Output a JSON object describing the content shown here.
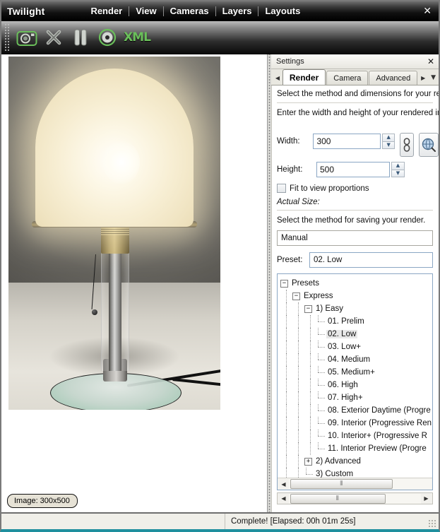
{
  "window": {
    "title": "Twilight",
    "close_label": "✕",
    "menu": [
      "Render",
      "View",
      "Cameras",
      "Layers",
      "Layouts"
    ]
  },
  "toolbar": {
    "buttons": [
      {
        "name": "render-camera-icon",
        "label": "camera-icon"
      },
      {
        "name": "cancel-render-icon",
        "label": "x-icon"
      },
      {
        "name": "pause-render-icon",
        "label": "pause-icon"
      },
      {
        "name": "save-render-icon",
        "label": "disc-icon"
      },
      {
        "name": "export-xml-icon",
        "label": "XML"
      }
    ]
  },
  "viewport": {
    "image_badge": "Image: 300x500"
  },
  "settings": {
    "title": "Settings",
    "close_label": "✕",
    "tabs": [
      {
        "label": "Render",
        "active": true
      },
      {
        "label": "Camera",
        "active": false
      },
      {
        "label": "Advanced",
        "active": false
      }
    ],
    "tab_prev": "◀",
    "tab_next": "▶",
    "tab_menu": "▼",
    "hint_method": "Select the method and dimensions for your ren",
    "hint_dimensions": "Enter the width and height of your rendered im",
    "width_label": "Width:",
    "width_value": "300",
    "height_label": "Height:",
    "height_value": "500",
    "spin_up": "▲",
    "spin_down": "▼",
    "lock_aspect_icon": "link-icon",
    "view_size_icon": "globe-zoom-icon",
    "fit_checkbox_label": "Fit to view proportions",
    "fit_checked": false,
    "actual_size_label": "Actual Size:",
    "hint_saving": "Select the method for saving your render.",
    "save_method_value": "Manual",
    "preset_label": "Preset:",
    "preset_value": "02. Low",
    "tree": [
      {
        "depth": 0,
        "label": "Presets",
        "expander": "−",
        "selected": false
      },
      {
        "depth": 1,
        "label": "Express",
        "expander": "−",
        "selected": false
      },
      {
        "depth": 2,
        "label": "1) Easy",
        "expander": "−",
        "selected": false
      },
      {
        "depth": 3,
        "label": "01. Prelim",
        "expander": "",
        "selected": false
      },
      {
        "depth": 3,
        "label": "02. Low",
        "expander": "",
        "selected": true
      },
      {
        "depth": 3,
        "label": "03. Low+",
        "expander": "",
        "selected": false
      },
      {
        "depth": 3,
        "label": "04. Medium",
        "expander": "",
        "selected": false
      },
      {
        "depth": 3,
        "label": "05. Medium+",
        "expander": "",
        "selected": false
      },
      {
        "depth": 3,
        "label": "06. High",
        "expander": "",
        "selected": false
      },
      {
        "depth": 3,
        "label": "07. High+",
        "expander": "",
        "selected": false
      },
      {
        "depth": 3,
        "label": "08. Exterior Daytime (Progre",
        "expander": "",
        "selected": false
      },
      {
        "depth": 3,
        "label": "09. Interior (Progressive Ren",
        "expander": "",
        "selected": false
      },
      {
        "depth": 3,
        "label": "10. Interior+ (Progressive R",
        "expander": "",
        "selected": false
      },
      {
        "depth": 3,
        "label": "11. Interior Preview (Progre",
        "expander": "",
        "selected": false
      },
      {
        "depth": 2,
        "label": "2) Advanced",
        "expander": "+",
        "selected": false
      },
      {
        "depth": 2,
        "label": "3) Custom",
        "expander": "",
        "selected": false
      }
    ],
    "scroll_left": "◀",
    "scroll_right": "▶",
    "scroll_grip": "⦀"
  },
  "status": {
    "text": "Complete!  [Elapsed: 00h 01m 25s]"
  },
  "colors": {
    "accent_green": "#6abf5a",
    "base_glass_green": "#1fa874",
    "window_bottom_accent": "#1f8f9e",
    "input_border": "#8ba7c4"
  }
}
